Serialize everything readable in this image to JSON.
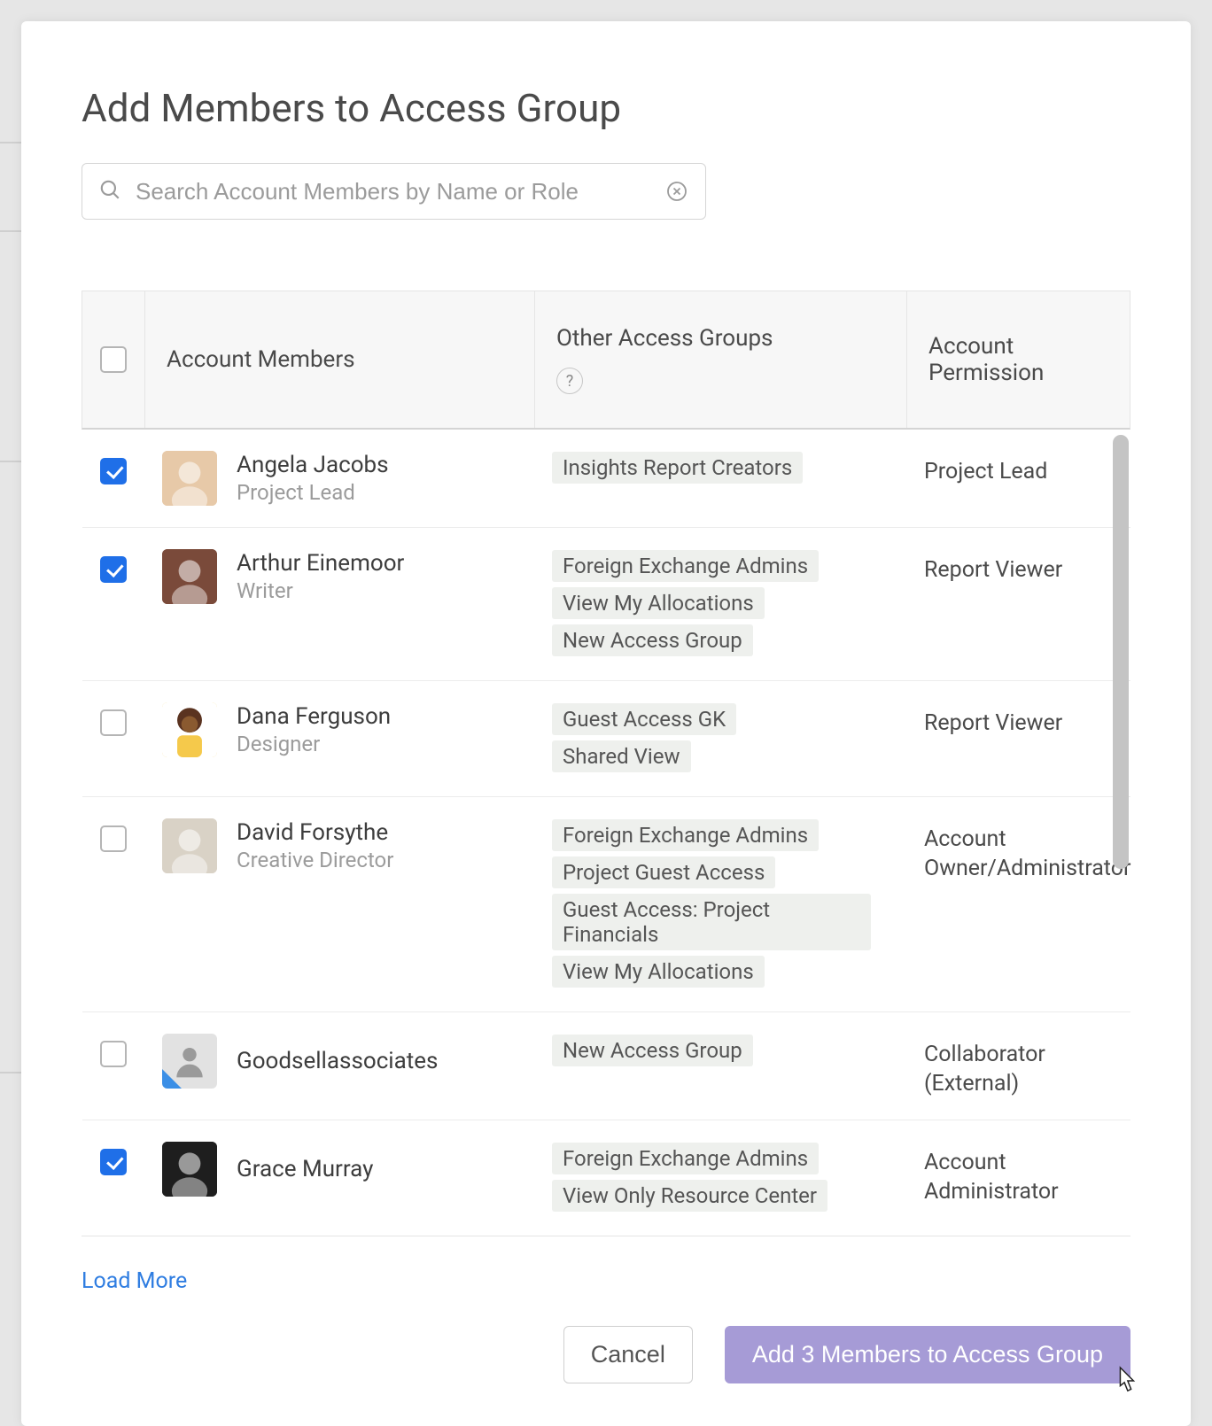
{
  "title": "Add Members to Access Group",
  "search": {
    "placeholder": "Search Account Members by Name or Role",
    "value": ""
  },
  "columns": {
    "members": "Account Members",
    "groups": "Other Access Groups",
    "permission": "Account Permission",
    "help_symbol": "?"
  },
  "members": [
    {
      "checked": true,
      "name": "Angela Jacobs",
      "role": "Project Lead",
      "groups": [
        "Insights Report Creators"
      ],
      "permission": "Project Lead",
      "avatar_bg": "#e7c9a8"
    },
    {
      "checked": true,
      "name": "Arthur Einemoor",
      "role": "Writer",
      "groups": [
        "Foreign Exchange Admins",
        "View My Allocations",
        "New Access Group"
      ],
      "permission": "Report Viewer",
      "avatar_bg": "#7a4a3a"
    },
    {
      "checked": false,
      "name": "Dana Ferguson",
      "role": "Designer",
      "groups": [
        "Guest Access GK",
        "Shared View"
      ],
      "permission": "Report Viewer",
      "avatar_bg": "#f5c94b",
      "avatar_style": "illustration"
    },
    {
      "checked": false,
      "name": "David Forsythe",
      "role": "Creative Director",
      "groups": [
        "Foreign Exchange Admins",
        "Project Guest Access",
        "Guest Access: Project Financials",
        "View My Allocations"
      ],
      "permission": "Account Owner/Administrator",
      "avatar_bg": "#d9d2c6"
    },
    {
      "checked": false,
      "name": "Goodsellassociates",
      "role": "",
      "groups": [
        "New Access Group"
      ],
      "permission": "Collaborator (External)",
      "avatar_bg": "#e2e2e2",
      "avatar_style": "generic",
      "corner_flag": true
    },
    {
      "checked": true,
      "name": "Grace Murray",
      "role": "",
      "groups": [
        "Foreign Exchange Admins",
        "View Only Resource Center"
      ],
      "permission": "Account Administrator",
      "avatar_bg": "#1e1e1e"
    }
  ],
  "loadMore": "Load More",
  "buttons": {
    "cancel": "Cancel",
    "addMembers": "Add 3 Members to Access Group"
  }
}
